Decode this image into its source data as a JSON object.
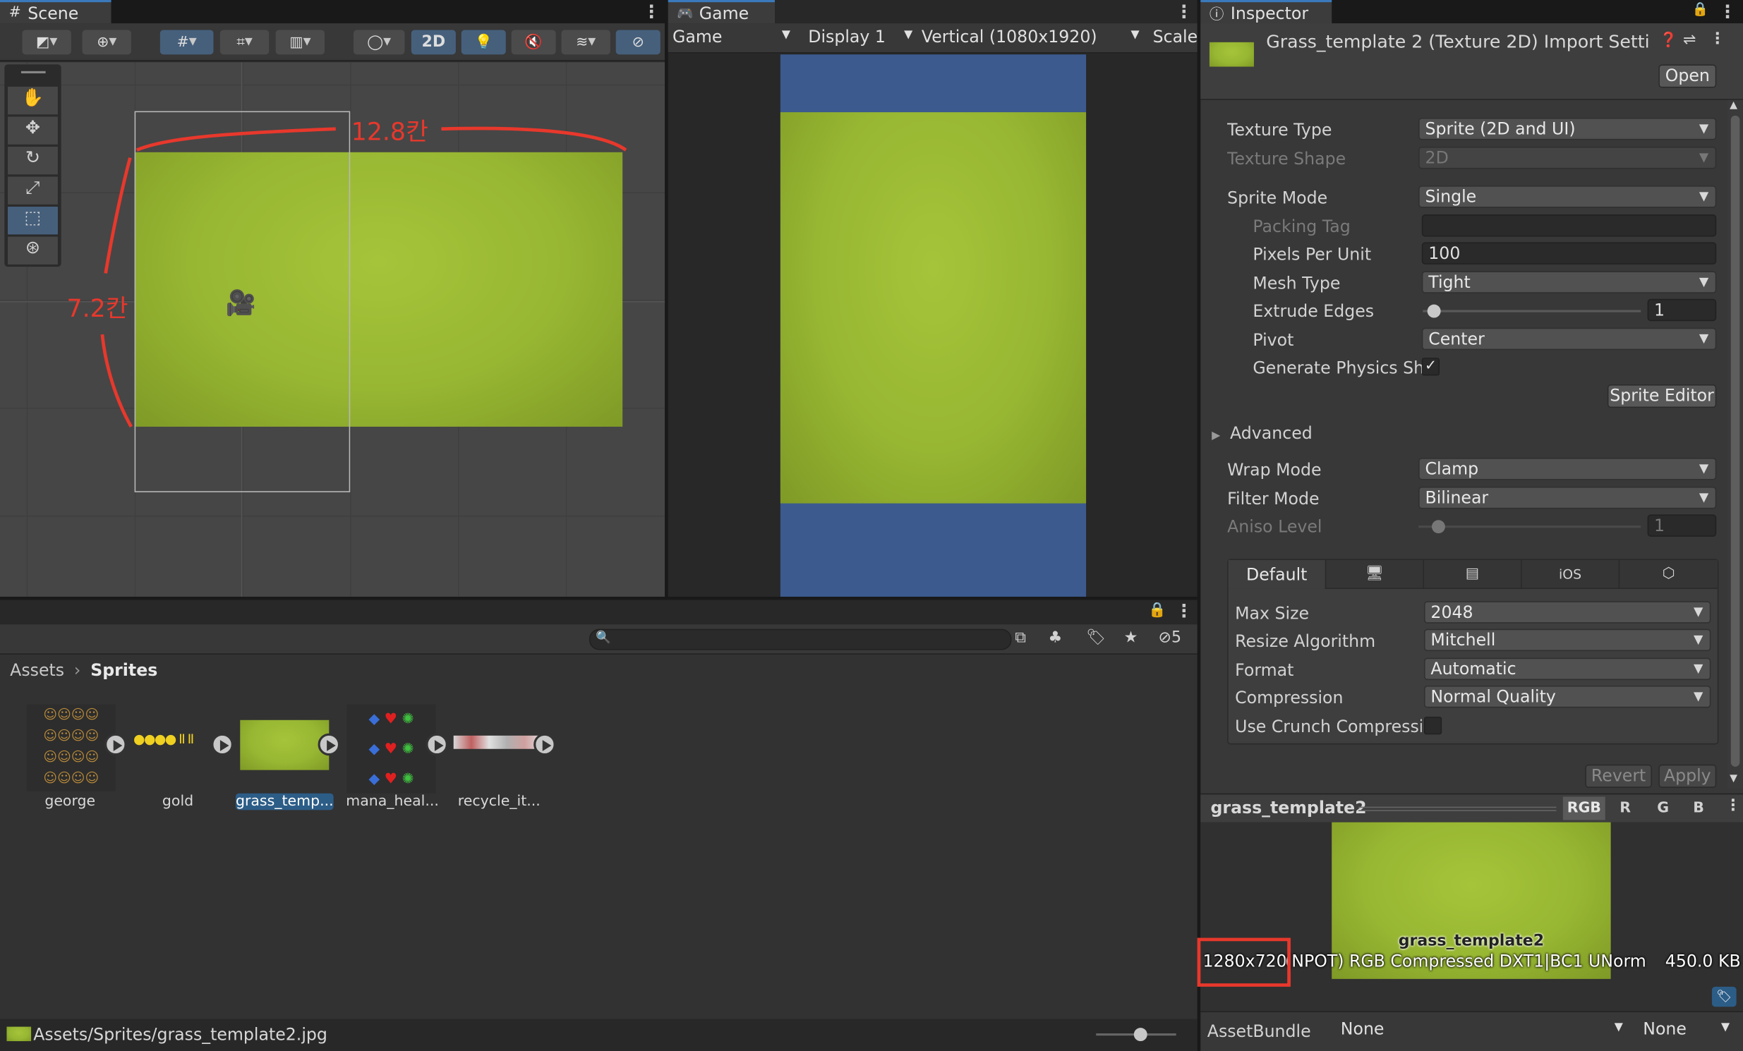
{
  "scene": {
    "tab": "Scene",
    "toolbar_2d": "2D",
    "annotation_width": "12.8칸",
    "annotation_height": "7.2칸"
  },
  "game": {
    "tab": "Game",
    "view_select": "Game",
    "display_select": "Display 1",
    "resolution_select": "Vertical (1080x1920)",
    "scale_label": "Scale"
  },
  "inspector": {
    "tab": "Inspector",
    "title": "Grass_template 2 (Texture 2D) Import Setti",
    "open_button": "Open",
    "texture_type": {
      "label": "Texture Type",
      "value": "Sprite (2D and UI)"
    },
    "texture_shape": {
      "label": "Texture Shape",
      "value": "2D"
    },
    "sprite_mode": {
      "label": "Sprite Mode",
      "value": "Single"
    },
    "packing_tag": {
      "label": "Packing Tag",
      "value": ""
    },
    "pixels_per_unit": {
      "label": "Pixels Per Unit",
      "value": "100"
    },
    "mesh_type": {
      "label": "Mesh Type",
      "value": "Tight"
    },
    "extrude_edges": {
      "label": "Extrude Edges",
      "value": "1"
    },
    "pivot": {
      "label": "Pivot",
      "value": "Center"
    },
    "generate_physics": {
      "label": "Generate Physics Sh",
      "checked": true
    },
    "sprite_editor_button": "Sprite Editor",
    "advanced": "Advanced",
    "wrap_mode": {
      "label": "Wrap Mode",
      "value": "Clamp"
    },
    "filter_mode": {
      "label": "Filter Mode",
      "value": "Bilinear"
    },
    "aniso_level": {
      "label": "Aniso Level",
      "value": "1"
    },
    "platform_tabs": [
      "Default",
      "standalone-icon",
      "server-icon",
      "iOS",
      "webgl-icon"
    ],
    "max_size": {
      "label": "Max Size",
      "value": "2048"
    },
    "resize_algorithm": {
      "label": "Resize Algorithm",
      "value": "Mitchell"
    },
    "format": {
      "label": "Format",
      "value": "Automatic"
    },
    "compression": {
      "label": "Compression",
      "value": "Normal Quality"
    },
    "use_crunch": {
      "label": "Use Crunch Compressic",
      "checked": false
    },
    "revert_button": "Revert",
    "apply_button": "Apply",
    "preview": {
      "name": "grass_template2",
      "channels": [
        "RGB",
        "R",
        "G",
        "B"
      ],
      "image_label": "grass_template2",
      "dimensions": "1280x720",
      "info": "(NPOT)  RGB Compressed DXT1|BC1 UNorm",
      "size": "450.0 KB"
    },
    "assetbundle": {
      "label": "AssetBundle",
      "value": "None",
      "variant": "None"
    }
  },
  "project": {
    "search_placeholder": "",
    "hidden_count": "5",
    "breadcrumb": [
      "Assets",
      "Sprites"
    ],
    "assets": [
      {
        "name": "george",
        "selected": false
      },
      {
        "name": "gold",
        "selected": false
      },
      {
        "name": "grass_temp...",
        "selected": true
      },
      {
        "name": "mana_heal...",
        "selected": false
      },
      {
        "name": "recycle_it...",
        "selected": false
      }
    ],
    "status_path": "Assets/Sprites/grass_template2.jpg"
  },
  "colors": {
    "accent": "#3a79bb",
    "annotation_red": "#e8382c",
    "grass": "#97b632",
    "game_bg": "#3c5a8e"
  }
}
